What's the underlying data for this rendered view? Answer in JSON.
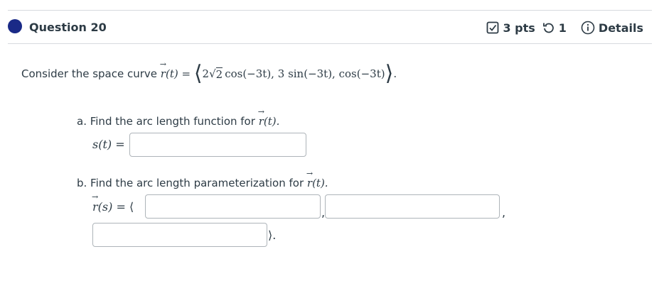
{
  "header": {
    "question_title": "Question 20",
    "points": "3 pts",
    "attempts": "1",
    "details_label": "Details",
    "accent_color": "#1a2a87"
  },
  "prompt": {
    "lead": "Consider the space curve",
    "r_sym": "r",
    "r_arg": "(t) =",
    "c1": "2",
    "sqrt_arg": "2",
    "cos1": "cos(−3t),",
    "c2": "3",
    "sin1": "sin(−3t),",
    "cos2": "cos(−3t)",
    "end": "."
  },
  "part_a": {
    "text": "a. Find the arc length function for",
    "r_sym": "r",
    "r_arg": "(t).",
    "answer_label": "s(t) =",
    "input_value": ""
  },
  "part_b": {
    "text": "b. Find the arc length parameterization for",
    "r_sym": "r",
    "r_arg": "(t).",
    "answer_r": "r",
    "answer_arg": "(s) =",
    "input1_value": "",
    "input2_value": "",
    "input3_value": "",
    "sep1": ",",
    "sep2": ",",
    "close": "⟩."
  },
  "icons": [
    "checkbox-icon",
    "retry-icon",
    "info-icon",
    "question-status-dot"
  ]
}
